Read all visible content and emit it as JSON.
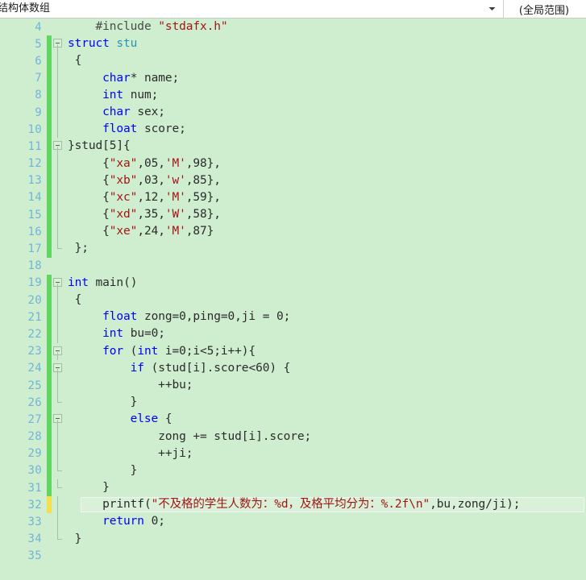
{
  "toolbar": {
    "file_selector_value": "结构体数组",
    "scope_selector_value": "(全局范围)",
    "dropdown_icon": "chevron-down-icon"
  },
  "editor": {
    "language": "C/C++",
    "first_visible_line": 4,
    "last_visible_line": 35,
    "colors": {
      "background": "#cfeed0",
      "line_number": "#70b4d8",
      "keyword": "#0000ff",
      "type": "#2b91af",
      "string": "#a31515",
      "plain": "#2b2b2b",
      "change_saved": "#61d761",
      "change_unsaved": "#f2e14c",
      "highlight_line": "#d8f1d8"
    },
    "lines": [
      {
        "n": 4,
        "change": "none",
        "fold": "none",
        "text": "    #include \"stdafx.h\""
      },
      {
        "n": 5,
        "change": "green",
        "fold": "start",
        "text": "struct stu"
      },
      {
        "n": 6,
        "change": "green",
        "fold": "mid",
        "text": " {"
      },
      {
        "n": 7,
        "change": "green",
        "fold": "mid",
        "text": "     char* name;"
      },
      {
        "n": 8,
        "change": "green",
        "fold": "mid",
        "text": "     int num;"
      },
      {
        "n": 9,
        "change": "green",
        "fold": "mid",
        "text": "     char sex;"
      },
      {
        "n": 10,
        "change": "green",
        "fold": "mid",
        "text": "     float score;"
      },
      {
        "n": 11,
        "change": "green",
        "fold": "start",
        "text": "}stud[5]{"
      },
      {
        "n": 12,
        "change": "green",
        "fold": "mid",
        "text": "     {\"xa\",05,'M',98},"
      },
      {
        "n": 13,
        "change": "green",
        "fold": "mid",
        "text": "     {\"xb\",03,'w',85},"
      },
      {
        "n": 14,
        "change": "green",
        "fold": "mid",
        "text": "     {\"xc\",12,'M',59},"
      },
      {
        "n": 15,
        "change": "green",
        "fold": "mid",
        "text": "     {\"xd\",35,'W',58},"
      },
      {
        "n": 16,
        "change": "green",
        "fold": "mid",
        "text": "     {\"xe\",24,'M',87}"
      },
      {
        "n": 17,
        "change": "green",
        "fold": "end",
        "text": " };"
      },
      {
        "n": 18,
        "change": "none",
        "fold": "none",
        "text": ""
      },
      {
        "n": 19,
        "change": "green",
        "fold": "start",
        "text": "int main()"
      },
      {
        "n": 20,
        "change": "green",
        "fold": "mid",
        "text": " {"
      },
      {
        "n": 21,
        "change": "green",
        "fold": "mid",
        "text": "     float zong=0,ping=0,ji = 0;"
      },
      {
        "n": 22,
        "change": "green",
        "fold": "mid",
        "text": "     int bu=0;"
      },
      {
        "n": 23,
        "change": "green",
        "fold": "start",
        "text": "     for (int i=0;i<5;i++){"
      },
      {
        "n": 24,
        "change": "green",
        "fold": "start",
        "text": "         if (stud[i].score<60) {"
      },
      {
        "n": 25,
        "change": "green",
        "fold": "mid",
        "text": "             ++bu;"
      },
      {
        "n": 26,
        "change": "green",
        "fold": "end",
        "text": "         }"
      },
      {
        "n": 27,
        "change": "green",
        "fold": "start",
        "text": "         else {"
      },
      {
        "n": 28,
        "change": "green",
        "fold": "mid",
        "text": "             zong += stud[i].score;"
      },
      {
        "n": 29,
        "change": "green",
        "fold": "mid",
        "text": "             ++ji;"
      },
      {
        "n": 30,
        "change": "green",
        "fold": "end",
        "text": "         }"
      },
      {
        "n": 31,
        "change": "green",
        "fold": "end",
        "text": "     }"
      },
      {
        "n": 32,
        "change": "yellow",
        "fold": "mid",
        "text": "     printf(\"不及格的学生人数为：%d，及格平均分为：%.2f\\n\",bu,zong/ji);"
      },
      {
        "n": 33,
        "change": "none",
        "fold": "mid",
        "text": "     return 0;"
      },
      {
        "n": 34,
        "change": "none",
        "fold": "end",
        "text": " }"
      },
      {
        "n": 35,
        "change": "none",
        "fold": "none",
        "text": ""
      }
    ],
    "highlighted_line": 32
  }
}
